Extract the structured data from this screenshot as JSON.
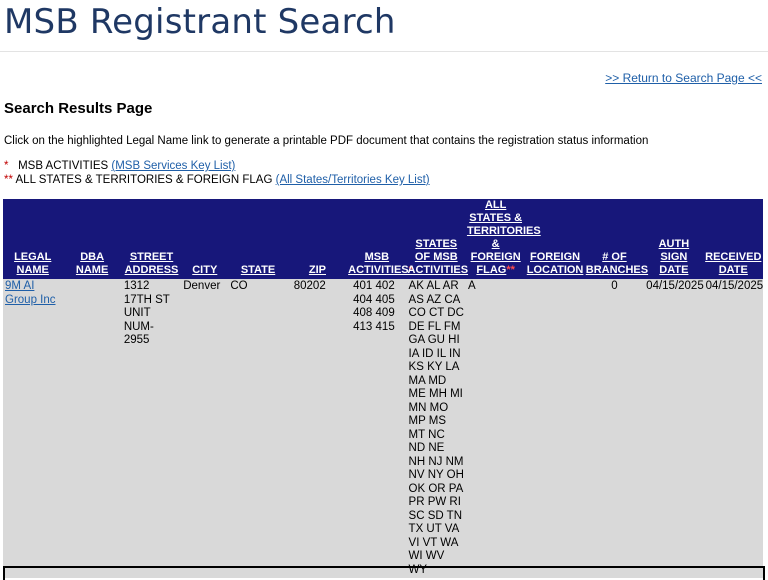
{
  "header": {
    "title": "MSB Registrant Search"
  },
  "nav": {
    "return_link": ">> Return to Search Page <<"
  },
  "results": {
    "heading": "Search Results Page",
    "instructions": "Click on the highlighted Legal Name link to generate a printable PDF document that contains the registration status information"
  },
  "legend": {
    "line1_star": "*",
    "line1_text": "MSB ACTIVITIES",
    "line1_link": "(MSB Services Key List)",
    "line2_star": "**",
    "line2_text": "ALL STATES & TERRITORIES & FOREIGN FLAG",
    "line2_link": "(All States/Territories Key List)"
  },
  "table": {
    "columns": [
      "LEGAL NAME",
      "DBA NAME",
      "STREET ADDRESS",
      "CITY",
      "STATE",
      "ZIP",
      "MSB ACTIVITIES",
      "STATES OF MSB ACTIVITIES",
      "ALL STATES & TERRITORIES & FOREIGN FLAG",
      "FOREIGN LOCATION",
      "# OF BRANCHES",
      "AUTH SIGN DATE",
      "RECEIVED DATE"
    ],
    "req_marks": {
      "msb_activities": "*",
      "all_states": "**"
    },
    "rows": [
      {
        "legal_name": "9M AI Group Inc",
        "dba_name": "",
        "street_address": "1312 17TH ST UNIT NUM-2955",
        "city": "Denver",
        "state": "CO",
        "zip": "80202",
        "msb_activities": "401 402 404 405 408 409 413 415",
        "states_of_activities": "AK AL AR AS AZ CA CO CT DC DE FL FM GA GU HI IA ID IL IN KS KY LA MA MD ME MH MI MN MO MP MS MT NC ND NE NH NJ NM NV NY OH OK OR PA PR PW RI SC SD TN TX UT VA VI VT WA WI WV WY",
        "all_states_flag": "A",
        "foreign_location": "",
        "branches": "0",
        "auth_sign_date": "04/15/2025",
        "received_date": "04/15/2025"
      }
    ]
  }
}
